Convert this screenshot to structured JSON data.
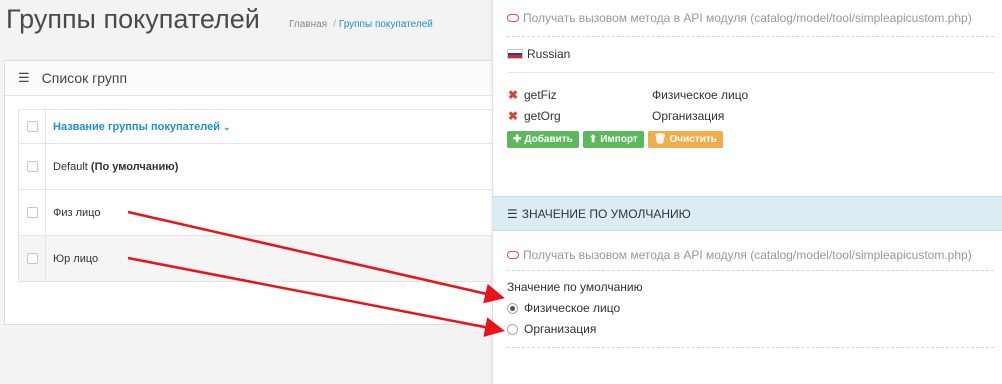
{
  "page": {
    "title": "Группы покупателей",
    "breadcrumb": {
      "home": "Главная",
      "separator": "/",
      "current": "Группы покупателей"
    }
  },
  "panel": {
    "header_icon": "list-icon",
    "header": "Список групп"
  },
  "table": {
    "column_header": "Название группы покупателей",
    "sort_icon": "chevron-down-icon",
    "rows": [
      {
        "name": "Default ",
        "suffix": "(По умолчанию)"
      },
      {
        "name": "Физ лицо",
        "suffix": ""
      },
      {
        "name": "Юр лицо",
        "suffix": ""
      }
    ]
  },
  "popup": {
    "api_note": "Получать вызовом метода в API модуля (catalog/model/tool/simpleapicustom.php)",
    "language": "Russian",
    "items": [
      {
        "key": "getFiz",
        "value": "Физическое лицо"
      },
      {
        "key": "getOrg",
        "value": "Организация"
      }
    ],
    "buttons": {
      "add": "Добавить",
      "import": "Импорт",
      "clear": "Очистить"
    },
    "default_section": {
      "title": "ЗНАЧЕНИЕ ПО УМОЛЧАНИЮ",
      "api_note": "Получать вызовом метода в API модуля (catalog/model/tool/simpleapicustom.php)",
      "label": "Значение по умолчанию",
      "options": [
        {
          "label": "Физическое лицо",
          "checked": true
        },
        {
          "label": "Организация",
          "checked": false
        }
      ]
    }
  },
  "colors": {
    "link": "#1e91cf",
    "btn_add": "#5cb85c",
    "btn_import": "#5cb85c",
    "btn_clear": "#f0ad4e",
    "arrow": "#e8141a",
    "section_bg": "#dcecf5"
  }
}
